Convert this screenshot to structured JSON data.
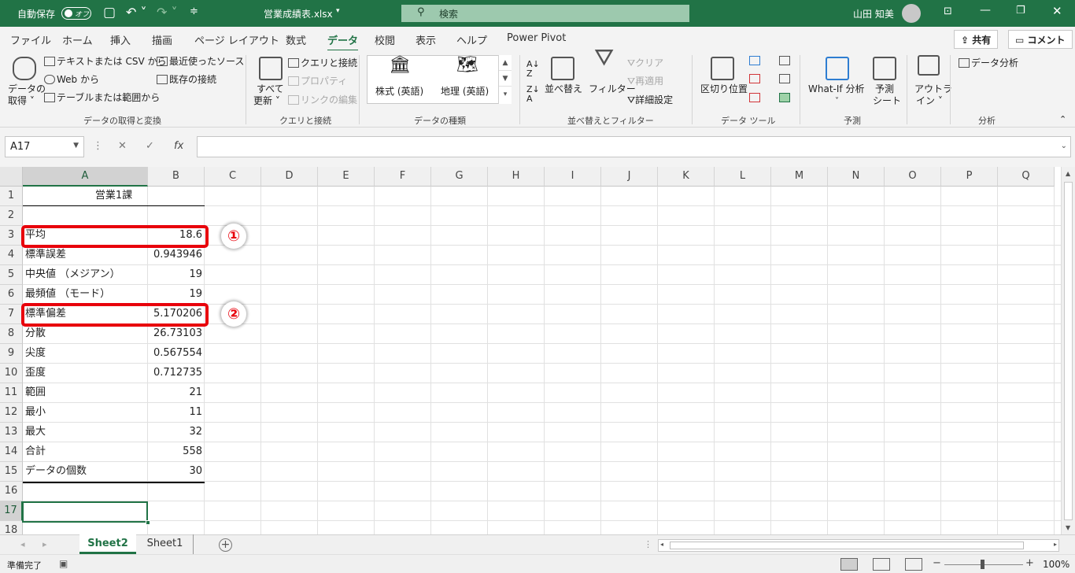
{
  "titlebar": {
    "autosave_label": "自動保存",
    "autosave_state": "オフ",
    "filename": "営業成績表.xlsx",
    "search_placeholder": "検索",
    "user": "山田 知美"
  },
  "tabs": [
    "ファイル",
    "ホーム",
    "挿入",
    "描画",
    "ページ レイアウト",
    "数式",
    "データ",
    "校閲",
    "表示",
    "ヘルプ",
    "Power Pivot"
  ],
  "active_tab": "データ",
  "share": {
    "share_label": "共有",
    "comment_label": "コメント"
  },
  "ribbon": {
    "get_data": {
      "big_label_1": "データの",
      "big_label_2": "取得",
      "from_text_csv": "テキストまたは CSV から",
      "from_web": "Web から",
      "from_table": "テーブルまたは範囲から",
      "recent_sources": "最近使ったソース",
      "existing_connections": "既存の接続",
      "group": "データの取得と変換"
    },
    "queries": {
      "refresh_1": "すべて",
      "refresh_2": "更新",
      "queries_connections": "クエリと接続",
      "properties": "プロパティ",
      "edit_links": "リンクの編集",
      "group": "クエリと接続"
    },
    "data_types": {
      "stocks": "株式 (英語)",
      "geography": "地理 (英語)",
      "group": "データの種類"
    },
    "sort_filter": {
      "sort": "並べ替え",
      "filter": "フィルター",
      "clear": "クリア",
      "reapply": "再適用",
      "advanced": "詳細設定",
      "group": "並べ替えとフィルター"
    },
    "data_tools": {
      "text_to_columns": "区切り位置",
      "group": "データ ツール"
    },
    "forecast": {
      "whatif": "What-If 分析",
      "forecast_sheet_1": "予測",
      "forecast_sheet_2": "シート",
      "group": "予測"
    },
    "outline": {
      "label_1": "アウトラ",
      "label_2": "イン"
    },
    "analysis": {
      "data_analysis": "データ分析",
      "group": "分析"
    }
  },
  "formula_bar": {
    "name_box": "A17",
    "formula": ""
  },
  "columns": [
    "A",
    "B",
    "C",
    "D",
    "E",
    "F",
    "G",
    "H",
    "I",
    "J",
    "K",
    "L",
    "M",
    "N",
    "O",
    "P",
    "Q"
  ],
  "rows": [
    "1",
    "2",
    "3",
    "4",
    "5",
    "6",
    "7",
    "8",
    "9",
    "10",
    "11",
    "12",
    "13",
    "14",
    "15",
    "16",
    "17",
    "18"
  ],
  "sheet": {
    "a1": "営業1課",
    "labels": [
      "平均",
      "標準誤差",
      "中央値 （メジアン）",
      "最頻値 （モード）",
      "標準偏差",
      "分散",
      "尖度",
      "歪度",
      "範囲",
      "最小",
      "最大",
      "合計",
      "データの個数"
    ],
    "values": [
      "18.6",
      "0.943946",
      "19",
      "19",
      "5.170206",
      "26.73103",
      "0.567554",
      "0.712735",
      "21",
      "11",
      "32",
      "558",
      "30"
    ]
  },
  "annotations": {
    "badge1": "①",
    "badge2": "②",
    "highlight_color": "#e8000b"
  },
  "sheet_tabs": [
    "Sheet2",
    "Sheet1"
  ],
  "active_sheet": "Sheet2",
  "status": {
    "ready": "準備完了",
    "zoom": "100%"
  },
  "colors": {
    "accent": "#217346"
  }
}
